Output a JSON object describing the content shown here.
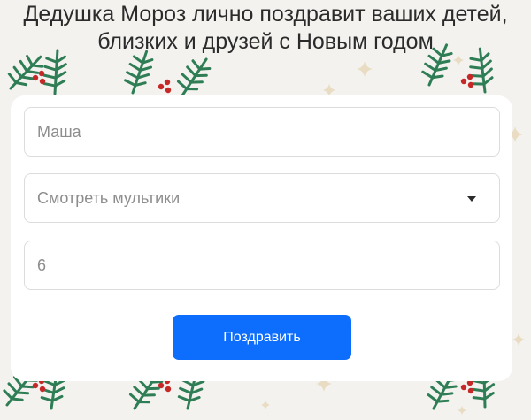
{
  "header": {
    "line1": "Дедушка Мороз лично поздравит ваших детей,",
    "line2": "близких и друзей с Новым годом"
  },
  "form": {
    "name_placeholder": "Маша",
    "activity_selected": "Смотреть мультики",
    "age_placeholder": "6",
    "submit_label": "Поздравить"
  },
  "colors": {
    "background": "#f3f2ef",
    "card": "#ffffff",
    "accent": "#0d6efd",
    "fir": "#2e7d55",
    "berry": "#c62828",
    "star": "#e9dcc2"
  },
  "icons": [
    "fir-branch-icon",
    "berry-icon",
    "sparkle-star-icon",
    "dropdown-caret-icon"
  ]
}
